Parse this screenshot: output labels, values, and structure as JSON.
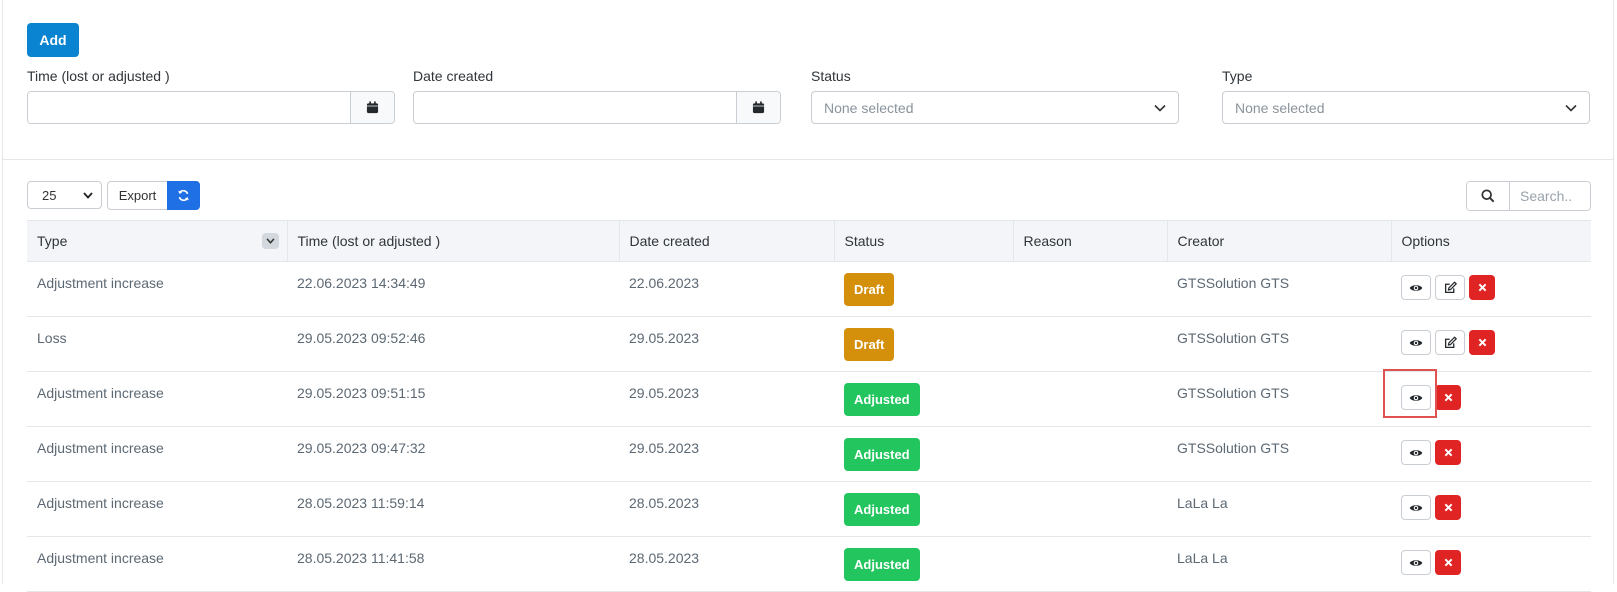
{
  "toolbar": {
    "add_label": "Add"
  },
  "filters": {
    "time": {
      "label": "Time (lost or adjusted )",
      "value": ""
    },
    "date_created": {
      "label": "Date created",
      "value": ""
    },
    "status": {
      "label": "Status",
      "selected": "None selected"
    },
    "type": {
      "label": "Type",
      "selected": "None selected"
    }
  },
  "table_controls": {
    "page_size": "25",
    "export_label": "Export",
    "search_placeholder": "Search.."
  },
  "table": {
    "columns": [
      "Type",
      "Time (lost or adjusted )",
      "Date created",
      "Status",
      "Reason",
      "Creator",
      "Options"
    ],
    "rows": [
      {
        "type": "Adjustment increase",
        "time": "22.06.2023 14:34:49",
        "date_created": "22.06.2023",
        "status": "Draft",
        "reason": "",
        "creator": "GTSSolution GTS",
        "options": [
          "view",
          "edit",
          "delete"
        ]
      },
      {
        "type": "Loss",
        "time": "29.05.2023 09:52:46",
        "date_created": "29.05.2023",
        "status": "Draft",
        "reason": "",
        "creator": "GTSSolution GTS",
        "options": [
          "view",
          "edit",
          "delete"
        ]
      },
      {
        "type": "Adjustment increase",
        "time": "29.05.2023 09:51:15",
        "date_created": "29.05.2023",
        "status": "Adjusted",
        "reason": "",
        "creator": "GTSSolution GTS",
        "options": [
          "view",
          "delete"
        ]
      },
      {
        "type": "Adjustment increase",
        "time": "29.05.2023 09:47:32",
        "date_created": "29.05.2023",
        "status": "Adjusted",
        "reason": "",
        "creator": "GTSSolution GTS",
        "options": [
          "view",
          "delete"
        ]
      },
      {
        "type": "Adjustment increase",
        "time": "28.05.2023 11:59:14",
        "date_created": "28.05.2023",
        "status": "Adjusted",
        "reason": "",
        "creator": "LaLa La",
        "options": [
          "view",
          "delete"
        ]
      },
      {
        "type": "Adjustment increase",
        "time": "28.05.2023 11:41:58",
        "date_created": "28.05.2023",
        "status": "Adjusted",
        "reason": "",
        "creator": "LaLa La",
        "options": [
          "view",
          "delete"
        ]
      }
    ]
  },
  "icons": {
    "calendar": "calendar-icon",
    "chevron": "chevron-down-icon",
    "refresh": "refresh-icon",
    "search": "search-icon",
    "view": "eye-icon",
    "edit": "edit-icon",
    "delete": "close-icon"
  },
  "colors": {
    "primary": "#0a84d0",
    "refresh": "#1f6fe5",
    "draft": "#d4900b",
    "adjusted": "#22c55e",
    "danger": "#e02424",
    "highlight": "#e05252"
  }
}
